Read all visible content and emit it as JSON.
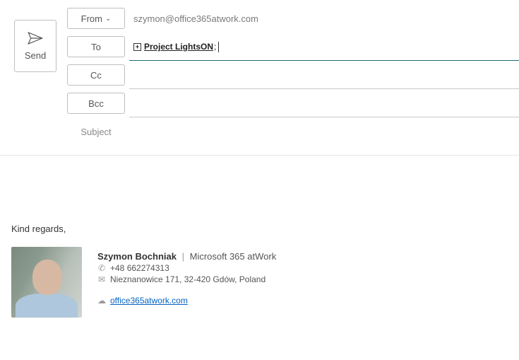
{
  "header": {
    "send_label": "Send",
    "from_label": "From",
    "from_value": "szymon@office365atwork.com",
    "to_label": "To",
    "to_recipient": "Project LightsON",
    "cc_label": "Cc",
    "cc_value": "",
    "bcc_label": "Bcc",
    "bcc_value": "",
    "subject_label": "Subject",
    "subject_value": ""
  },
  "body": {
    "closing": "Kind regards,"
  },
  "signature": {
    "name": "Szymon Bochniak",
    "separator": "|",
    "company": "Microsoft 365 atWork",
    "phone": "+48 662274313",
    "address": "Nieznanowice 171, 32-420 Gdów, Poland",
    "website": "office365atwork.com"
  }
}
